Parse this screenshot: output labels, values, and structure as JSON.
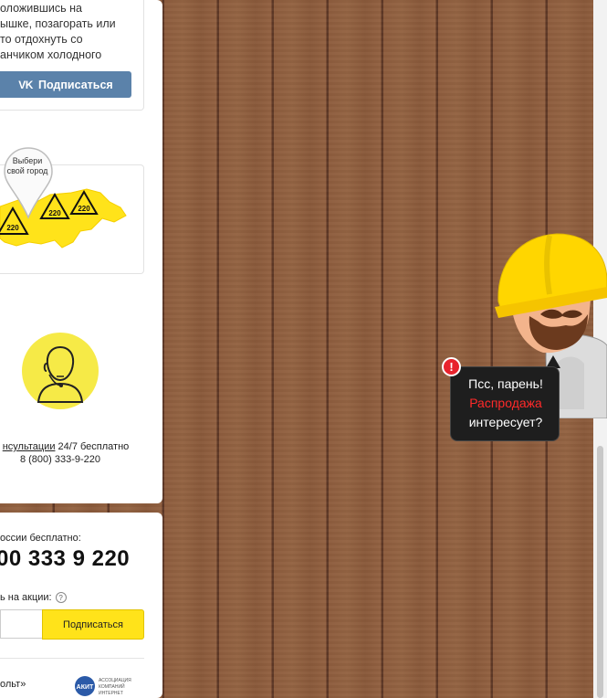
{
  "vk_widget": {
    "text": "оложившись на\nышке, позагорать или\nто отдохнуть со\nанчиком холодного",
    "logo": "VK",
    "button_label": "Подписаться"
  },
  "city_picker": {
    "pin_label": "Выбери свой город",
    "badge_label": "220"
  },
  "support": {
    "link_text": "нсультации",
    "rest_text": " 24/7 бесплатно",
    "phone": "8 (800) 333-9-220"
  },
  "footer": {
    "free_label": "оссии бесплатно:",
    "big_phone": "00 333 9 220",
    "subscribe_label": "ь на акции:",
    "help_glyph": "?",
    "subscribe_button": "Подписаться",
    "bottom_text": "ольт»",
    "akit_logo": "АКИТ",
    "akit_text": "АССОЦИАЦИЯ КОМПАНИЙ ИНТЕРНЕТ ТОРГОВЛИ"
  },
  "promo_bubble": {
    "line1": "Псс, парень!",
    "line2": "Распродажа",
    "line3": "интересует?",
    "alert_glyph": "!"
  },
  "colors": {
    "vk_blue": "#5b82aa",
    "accent_yellow": "#ffe31a",
    "alert_red": "#e8232d",
    "bubble_bg": "#1e1e1e"
  }
}
